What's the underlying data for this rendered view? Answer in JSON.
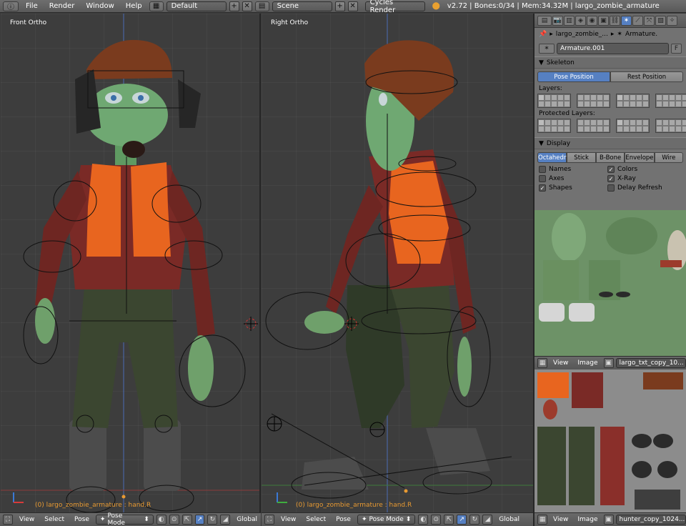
{
  "topbar": {
    "menus": [
      "File",
      "Render",
      "Window",
      "Help"
    ],
    "screen_layout": "Default",
    "scene": "Scene",
    "render_engine": "Cycles Render",
    "stats": "v2.72 | Bones:0/34 | Mem:34.32M | largo_zombie_armature"
  },
  "viewports": {
    "left": {
      "label": "Front Ortho",
      "object_info": "(0) largo_zombie_armature : hand.R",
      "footer": {
        "view": "View",
        "select": "Select",
        "pose": "Pose",
        "mode": "Pose Mode",
        "orientation": "Global"
      }
    },
    "right": {
      "label": "Right Ortho",
      "object_info": "(0) largo_zombie_armature : hand.R",
      "footer": {
        "view": "View",
        "select": "Select",
        "pose": "Pose",
        "mode": "Pose Mode",
        "orientation": "Global"
      }
    }
  },
  "properties": {
    "breadcrumb": [
      "largo_zombie_...",
      "Armature."
    ],
    "armature_name": "Armature.001",
    "fake_user": "F",
    "skeleton": {
      "title": "Skeleton",
      "position_options": [
        "Pose Position",
        "Rest Position"
      ],
      "active_position": "Pose Position",
      "layers_label": "Layers:",
      "protected_label": "Protected Layers:"
    },
    "display": {
      "title": "Display",
      "modes": [
        "Octahedr",
        "Stick",
        "B-Bone",
        "Envelope",
        "Wire"
      ],
      "active_mode": "Octahedr",
      "options": [
        {
          "label": "Names",
          "checked": false
        },
        {
          "label": "Colors",
          "checked": true
        },
        {
          "label": "Axes",
          "checked": false
        },
        {
          "label": "X-Ray",
          "checked": true
        },
        {
          "label": "Shapes",
          "checked": true
        },
        {
          "label": "Delay Refresh",
          "checked": false
        }
      ]
    }
  },
  "uv_editors": {
    "top": {
      "view": "View",
      "image": "Image",
      "image_name": "largo_txt_copy_10..."
    },
    "bottom": {
      "view": "View",
      "image": "Image",
      "image_name": "hunter_copy_1024...."
    }
  },
  "colors": {
    "accent": "#5680c2",
    "viewport_bg": "#3d3d3d",
    "panel_bg": "#727272",
    "info_text": "#e89a32"
  }
}
